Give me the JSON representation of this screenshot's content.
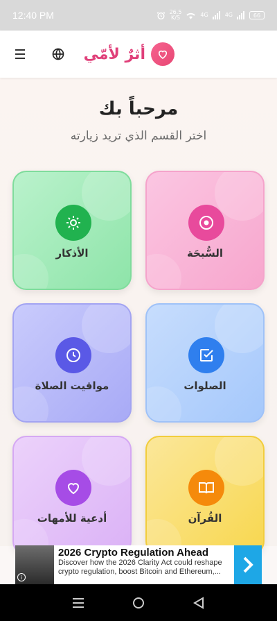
{
  "status_bar": {
    "time": "12:40 PM",
    "speed": "26.5",
    "speed_unit": "K/S",
    "network1": "4G",
    "network2": "4G",
    "battery": "66"
  },
  "app_bar": {
    "brand_name": "أثرٌ لأمّي",
    "icons": [
      "menu-icon",
      "globe-icon",
      "heart-icon"
    ]
  },
  "main": {
    "title": "مرحباً بك",
    "subtitle": "اختر القسم الذي تريد زيارته",
    "cards": [
      {
        "label": "السُّبحَة",
        "icon": "target-icon",
        "color": "#e84a9c"
      },
      {
        "label": "الأذكار",
        "icon": "sun-icon",
        "color": "#21b24f"
      },
      {
        "label": "الصلوات",
        "icon": "checkbox-icon",
        "color": "#2f7fee"
      },
      {
        "label": "مواقيت الصلاة",
        "icon": "clock-icon",
        "color": "#5a59e6"
      },
      {
        "label": "القُرآن",
        "icon": "book-icon",
        "color": "#f58a0b"
      },
      {
        "label": "أدعية للأمهات",
        "icon": "heart-icon",
        "color": "#a64ce6"
      }
    ]
  },
  "ad": {
    "title": "2026 Crypto Regulation Ahead",
    "description": "Discover how the 2026 Clarity Act could reshape crypto regulation, boost Bitcoin and Ethereum,...",
    "info": "i"
  },
  "nav_bar": {
    "icons": [
      "recents-icon",
      "home-icon",
      "back-icon"
    ]
  }
}
